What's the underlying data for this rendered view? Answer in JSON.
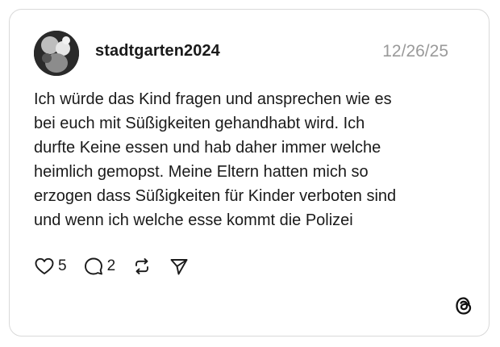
{
  "post": {
    "username": "stadtgarten2024",
    "date": "12/26/25",
    "text": "Ich würde das Kind fragen und ansprechen wie es\nbei euch mit Süßigkeiten gehandhabt wird. Ich\ndurfte Keine essen und hab daher immer welche\nheimlich gemopst. Meine Eltern hatten mich so\nerzogen dass Süßigkeiten für Kinder verboten sind\nund wenn ich welche esse kommt die Polizei"
  },
  "actions": {
    "likes": "5",
    "replies": "2",
    "like_icon": "heart-icon",
    "reply_icon": "comment-icon",
    "repost_icon": "repost-icon",
    "share_icon": "send-icon"
  },
  "branding": {
    "logo_icon": "threads-logo-icon"
  }
}
